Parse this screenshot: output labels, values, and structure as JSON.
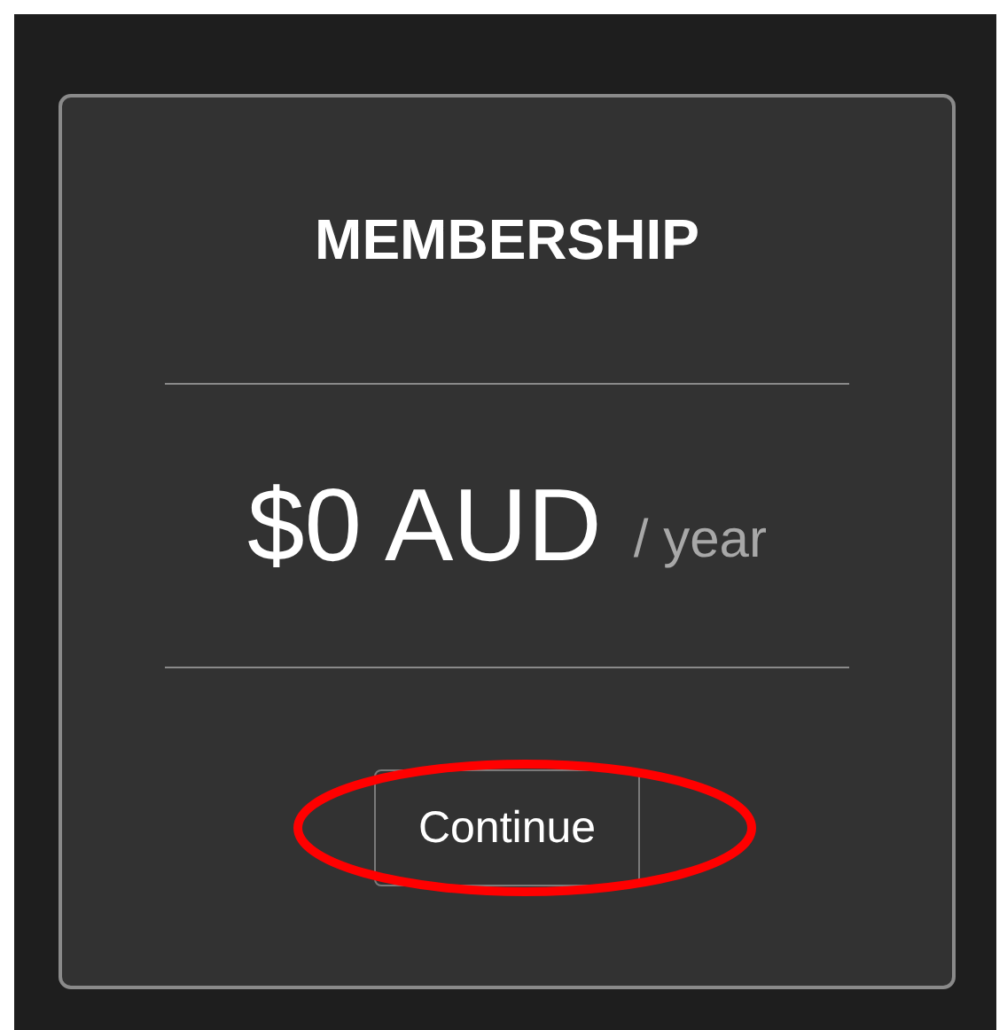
{
  "card": {
    "title": "MEMBERSHIP",
    "price": "$0 AUD",
    "period": "/ year",
    "button": "Continue"
  },
  "annotation": {
    "kind": "ellipse",
    "color": "#ff0000"
  }
}
